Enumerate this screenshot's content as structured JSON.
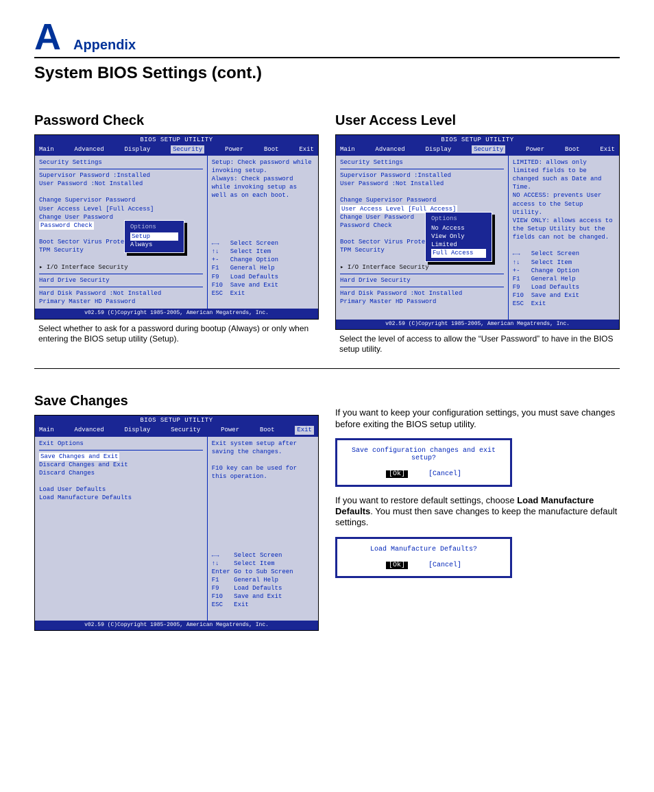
{
  "header": {
    "letter": "A",
    "label": "Appendix"
  },
  "title": "System BIOS Settings (cont.)",
  "bios_common": {
    "utility_title": "BIOS SETUP UTILITY",
    "menus": [
      "Main",
      "Advanced",
      "Display",
      "Security",
      "Power",
      "Boot",
      "Exit"
    ],
    "copyright": "v02.59 (C)Copyright 1985-2005, American Megatrends, Inc.",
    "keys": {
      "select_screen": "Select Screen",
      "select_item": "Select Item",
      "change_option": "Change Option",
      "general_help": "General Help",
      "load_defaults": "Load Defaults",
      "save_exit": "Save and Exit",
      "exit": "Exit",
      "go_sub": "Go to Sub Screen"
    }
  },
  "security_body": {
    "heading": "Security Settings",
    "supervisor": "Supervisor Password :Installed",
    "user": "User Password       :Not Installed",
    "change_sup": "Change Supervisor Password",
    "user_access": "User Access Level          [Full Access]",
    "change_user": "Change User Password",
    "password_check": "Password Check",
    "boot_sector": "Boot Sector Virus Protectio",
    "tpm": "TPM Security",
    "io_if": "▸ I/O Interface Security",
    "hd_heading": "Hard Drive Security",
    "hd_pw": "Hard Disk Password   :Not Installed",
    "primary": "Primary Master HD Password"
  },
  "password_check": {
    "heading": "Password Check",
    "help": "Setup: Check password while invoking setup.\nAlways: Check password while invoking setup as well as on each boot.",
    "popup": {
      "title": "Options",
      "items": [
        "Setup",
        "Always"
      ],
      "selected": "Setup"
    },
    "caption": "Select whether to ask for a password during bootup (Always) or only when entering the BIOS setup utility (Setup)."
  },
  "user_access": {
    "heading": "User Access Level",
    "help": "LIMITED: allows only limited fields to be changed such as Date and Time.\nNO ACCESS: prevents User access to the Setup Utility.\nVIEW ONLY: allows access to the Setup Utility but the fields can not be changed.",
    "popup": {
      "title": "Options",
      "items": [
        "No Access",
        "View Only",
        "Limited",
        "Full Access"
      ],
      "selected": "Full Access"
    },
    "caption": "Select the level of access to allow the “User Password” to have in the BIOS setup utility."
  },
  "save_changes": {
    "heading": "Save Changes",
    "exit_heading": "Exit Options",
    "items": [
      "Save Changes and Exit",
      "Discard Changes and Exit",
      "Discard Changes",
      "",
      "Load User Defaults",
      "Load Manufacture Defaults"
    ],
    "highlight": "Save Changes and Exit",
    "help": "Exit system setup after saving the changes.\n\nF10 key can be used for this operation.",
    "body1": "If you want to keep your configuration settings, you must save changes before exiting the BIOS setup utility.",
    "dialog1": {
      "msg": "Save configuration changes and exit setup?",
      "ok": "[Ok]",
      "cancel": "[Cancel]"
    },
    "body2a": "If you want to restore default settings, choose ",
    "body2b": "Load Manufacture Defaults",
    "body2c": ". You must then save changes to keep the manufacture default settings.",
    "dialog2": {
      "msg": "Load Manufacture Defaults?",
      "ok": "[Ok]",
      "cancel": "[Cancel]"
    }
  }
}
